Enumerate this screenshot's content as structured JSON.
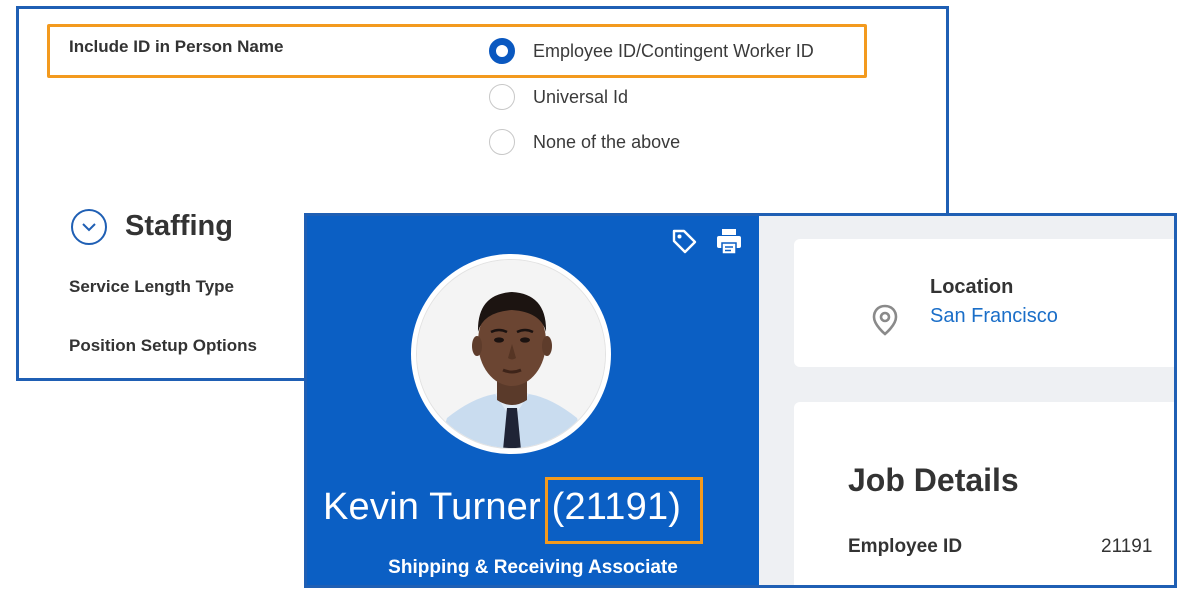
{
  "settings": {
    "include_id_label": "Include ID in Person Name",
    "options": [
      {
        "label": "Employee ID/Contingent Worker ID",
        "selected": true
      },
      {
        "label": "Universal Id",
        "selected": false
      },
      {
        "label": "None of the above",
        "selected": false
      }
    ],
    "section_title": "Staffing",
    "service_length_label": "Service Length Type",
    "position_setup_label": "Position Setup Options"
  },
  "profile": {
    "name": "Kevin Turner",
    "id_display": "(21191)",
    "job_title": "Shipping & Receiving Associate",
    "location_label": "Location",
    "location_value": "San Francisco",
    "job_details_title": "Job Details",
    "employee_id_label": "Employee ID",
    "employee_id_value": "21191"
  },
  "icons": {
    "tag": "tag-icon",
    "print": "print-icon",
    "location": "map-pin-icon",
    "collapse": "chevron-down-icon"
  },
  "colors": {
    "brand_blue": "#0b5fc4",
    "highlight_orange": "#f39a1e",
    "link_blue": "#1a6ec8",
    "radio_selected": "#0a58c0"
  }
}
